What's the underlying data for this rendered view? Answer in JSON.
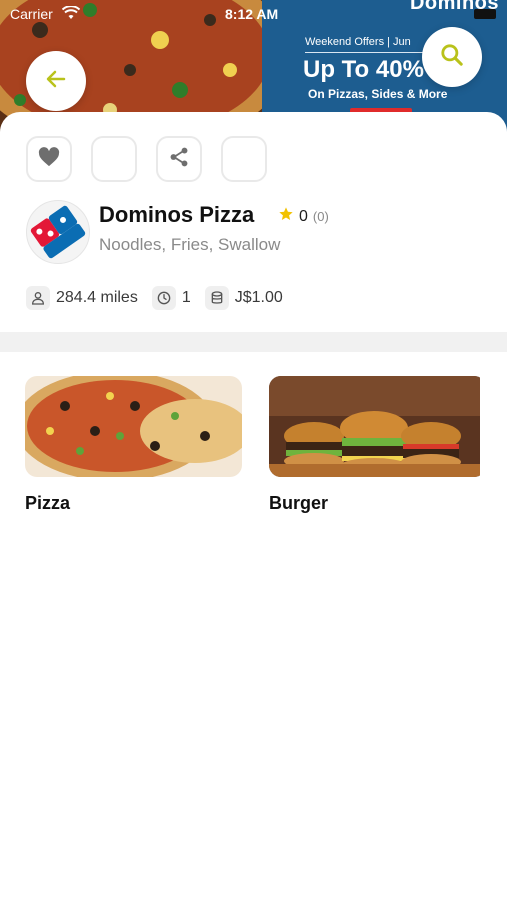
{
  "status_bar": {
    "carrier": "Carrier",
    "time": "8:12 AM"
  },
  "banner": {
    "brand": "Dominos",
    "offer_line": "Weekend Offers | Jun",
    "headline": "Up To 40%",
    "subline": "On Pizzas, Sides & More"
  },
  "actions": {
    "back_icon": "arrow-left-icon",
    "search_icon": "search-icon",
    "favorite_icon": "heart-icon",
    "share_icon": "share-icon"
  },
  "store": {
    "name": "Dominos Pizza",
    "rating": "0",
    "rating_count": "(0)",
    "cuisine": "Noodles, Fries, Swallow",
    "logo_text": "Domino's Pizza"
  },
  "meta": {
    "distance": "284.4 miles",
    "time": "1",
    "price": "J$1.00"
  },
  "categories": [
    {
      "label": "Pizza"
    },
    {
      "label": "Burger"
    }
  ],
  "colors": {
    "accent": "#b9c21b",
    "star": "#f2c200",
    "banner_blue": "#1d5d90"
  }
}
